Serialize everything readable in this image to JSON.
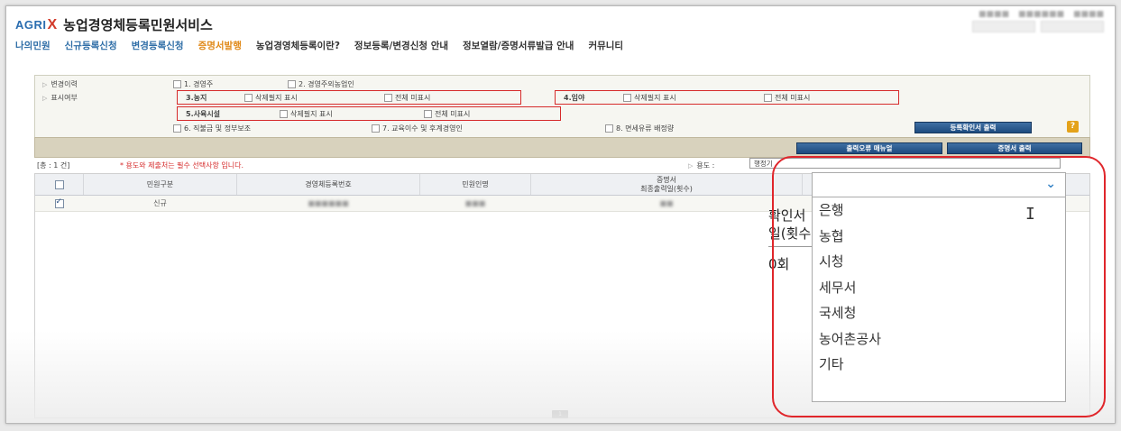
{
  "header": {
    "logo_agri": "AGRI",
    "logo_x": "X",
    "title": "농업경영체등록민원서비스",
    "top_links": [
      "",
      "",
      ""
    ],
    "top_buttons": [
      "",
      ""
    ]
  },
  "nav": {
    "items": [
      {
        "label": "나의민원",
        "style": "blue"
      },
      {
        "label": "신규등록신청",
        "style": "blue"
      },
      {
        "label": "변경등록신청",
        "style": "blue"
      },
      {
        "label": "증명서발행",
        "style": "orange"
      },
      {
        "label": "농업경영체등록이란?",
        "style": "dark"
      },
      {
        "label": "정보등록/변경신청 안내",
        "style": "dark"
      },
      {
        "label": "정보열람/증명서류발급 안내",
        "style": "dark"
      },
      {
        "label": "커뮤니티",
        "style": "dark"
      }
    ]
  },
  "options": {
    "change_history": "변경이력",
    "display_flag": "표시여부",
    "opt1": "1. 경영주",
    "opt2": "2. 경영주외농업인",
    "farmland": "3.농지",
    "forest": "4.임야",
    "livestock": "5.사육시설",
    "show_deleted": "삭제필지 표시",
    "hide_all": "전체 미표시",
    "opt6": "6. 직불금 및 정부보조",
    "opt7": "7. 교육이수 및 후계경영인",
    "opt8": "8. 면세유류 배정량",
    "print_confirm_button": "등록확인서 출력",
    "help_label": "?"
  },
  "actions": {
    "error_manual_button": "출력오류 매뉴얼",
    "print_cert_button": "증명서 출력"
  },
  "info": {
    "count": "[총 : 1 건]",
    "warning": "* 용도와 제출처는 필수 선택사항 입니다.",
    "usage_label": "용도 :",
    "usage_value": "행정기"
  },
  "table": {
    "headers": [
      "",
      "민원구분",
      "경영체등록번호",
      "민원인명",
      "증명서\n최종출력일(횟수)"
    ],
    "rows": [
      {
        "checked": true,
        "type": "신규",
        "reg_no": "",
        "name": "",
        "printed": ""
      }
    ],
    "page": "1"
  },
  "zoomed_background": {
    "line1": "확인서",
    "line2": "일(횟수",
    "line3": "0회"
  },
  "dropdown": {
    "selected": "",
    "options": [
      "은행",
      "농협",
      "시청",
      "세무서",
      "국세청",
      "농어촌공사",
      "기타"
    ]
  },
  "colors": {
    "brand_blue": "#2f6ea7",
    "nav_orange": "#e08a1a",
    "highlight_red": "#e0262b",
    "button_navy": "#1d4b7f"
  }
}
